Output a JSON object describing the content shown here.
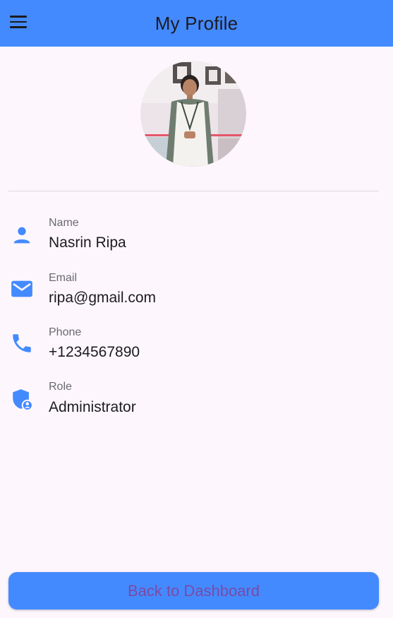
{
  "appbar": {
    "title": "My Profile",
    "menu_icon": "menu-icon",
    "color": "#448aff"
  },
  "profile": {
    "avatar_icon": "profile-photo",
    "fields": [
      {
        "label": "Name",
        "value": "Nasrin Ripa",
        "icon": "person-icon"
      },
      {
        "label": "Email",
        "value": "ripa@gmail.com",
        "icon": "email-icon"
      },
      {
        "label": "Phone",
        "value": "+1234567890",
        "icon": "phone-icon"
      },
      {
        "label": "Role",
        "value": "Administrator",
        "icon": "admin-shield-icon"
      }
    ]
  },
  "actions": {
    "back_label": "Back to Dashboard"
  },
  "colors": {
    "accent": "#448aff",
    "background": "#fdf7fd",
    "button_text": "#7b4aa4"
  }
}
